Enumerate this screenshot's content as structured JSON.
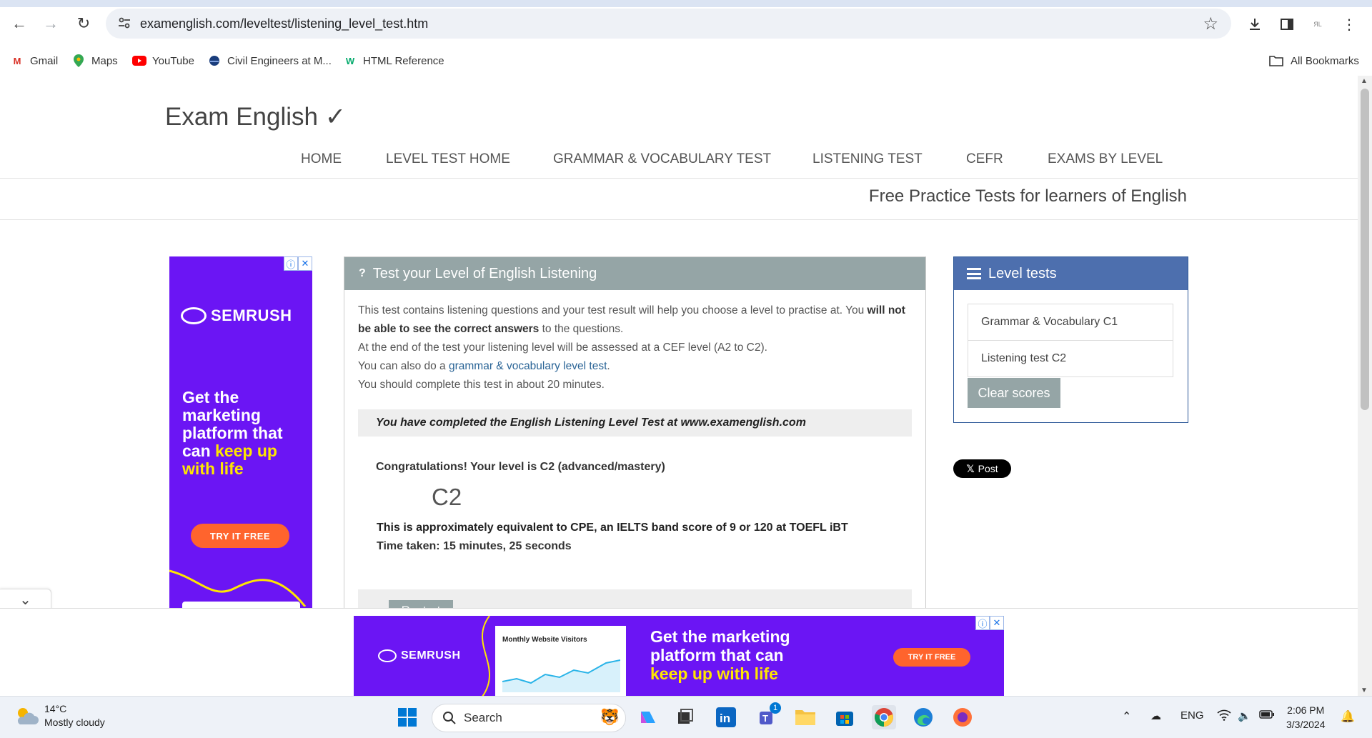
{
  "browser": {
    "url": "examenglish.com/leveltest/listening_level_test.htm",
    "bookmarks": [
      "Gmail",
      "Maps",
      "YouTube",
      "Civil Engineers at M...",
      "HTML Reference"
    ],
    "all_bookmarks": "All Bookmarks"
  },
  "site": {
    "logo": "Exam English ✓",
    "nav": [
      "HOME",
      "LEVEL TEST HOME",
      "GRAMMAR & VOCABULARY TEST",
      "LISTENING TEST",
      "CEFR",
      "EXAMS BY LEVEL"
    ],
    "tagline": "Free Practice Tests for learners of English"
  },
  "test_panel": {
    "title": "Test your Level of English Listening",
    "intro_1a": "This test contains listening questions and your test result will help you choose a level to practise at. You ",
    "intro_1b": "will not be able to see the correct answers",
    "intro_1c": " to the questions.",
    "intro_2": "At the end of the test your listening level will be assessed at a CEF level (A2 to C2).",
    "intro_3a": "You can also do a ",
    "intro_3_link": "grammar & vocabulary level test",
    "intro_3c": ".",
    "intro_4": "You should complete this test in about 20 minutes.",
    "completed": "You have completed the English Listening Level Test at www.examenglish.com",
    "congrats": "Congratulations! Your level is C2 (advanced/mastery)",
    "level": "C2",
    "equivalent": "This is approximately equivalent to CPE, an IELTS band score of 9 or 120 at TOEFL iBT",
    "time_taken": "Time taken: 15 minutes, 25 seconds",
    "restart": "Restart"
  },
  "level_tests": {
    "title": "Level tests",
    "items": [
      "Grammar & Vocabulary C1",
      "Listening test C2"
    ],
    "clear": "Clear scores"
  },
  "x_post": "Post",
  "ad_left": {
    "brand": "SEMRUSH",
    "line1": "Get the",
    "line2": "marketing",
    "line3": "platform that",
    "line4a": "can ",
    "line4b": "keep up",
    "line5": "with life",
    "cta": "TRY IT FREE"
  },
  "ad_bottom": {
    "brand": "SEMRUSH",
    "card_title": "Monthly Website Visitors",
    "line1": "Get the marketing",
    "line2": "platform that can",
    "line3": "keep up with life",
    "cta": "TRY IT FREE"
  },
  "taskbar": {
    "temp": "14°C",
    "weather": "Mostly cloudy",
    "search": "Search",
    "lang": "ENG",
    "time": "2:06 PM",
    "date": "3/3/2024",
    "teams_badge": "1"
  },
  "colors": {
    "panel_head": "#95a5a6",
    "side_head": "#4d6fae",
    "ad_purple": "#6b15f4",
    "ad_cta": "#ff642d"
  }
}
